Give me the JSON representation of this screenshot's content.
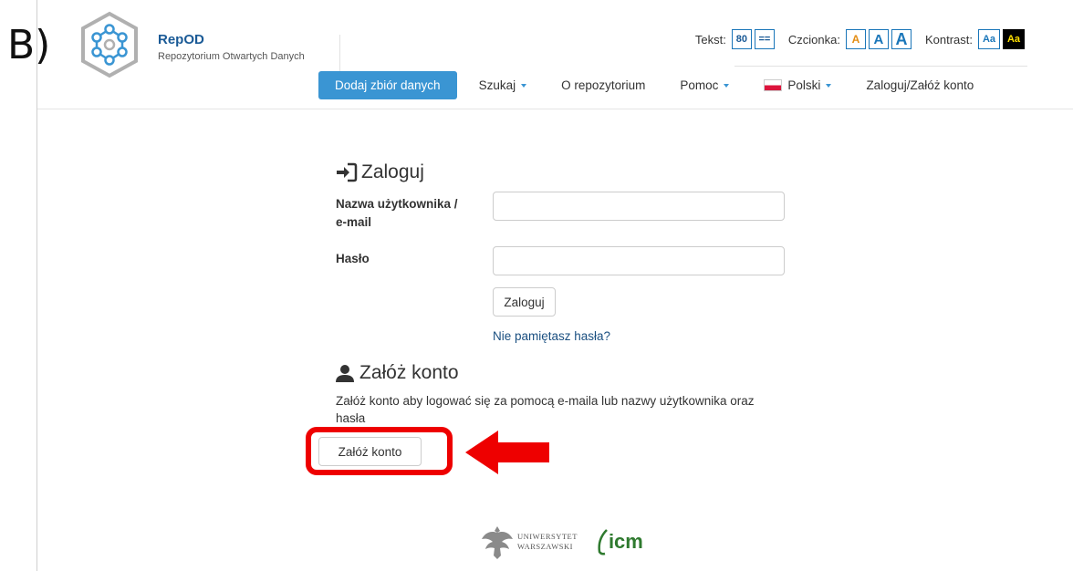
{
  "panel_label": "B)",
  "brand": {
    "title": "RepOD",
    "subtitle": "Repozytorium Otwartych Danych"
  },
  "accessibility": {
    "text_label": "Tekst:",
    "text_option_1": "80",
    "text_option_2": "==",
    "font_label": "Czcionka:",
    "font_small": "A",
    "font_medium": "A",
    "font_large": "A",
    "contrast_label": "Kontrast:",
    "contrast_normal": "Aa",
    "contrast_high": "Aa"
  },
  "nav": {
    "add_dataset": "Dodaj zbiór danych",
    "search": "Szukaj",
    "about": "O repozytorium",
    "help": "Pomoc",
    "language": "Polski",
    "login_signup": "Zaloguj/Załóż konto"
  },
  "login": {
    "title": "Zaloguj",
    "username_label_line1": "Nazwa użytkownika /",
    "username_label_line2": "e-mail",
    "username_value": "",
    "password_label": "Hasło",
    "password_value": "",
    "submit": "Zaloguj",
    "forgot": "Nie pamiętasz hasła?"
  },
  "signup": {
    "title": "Załóż konto",
    "description": "Załóż konto aby logować się za pomocą e-maila lub nazwy użytkownika oraz hasła",
    "button": "Załóż konto"
  },
  "footer": {
    "university_line1": "UNIWERSYTET",
    "university_line2": "WARSZAWSKI",
    "icm": "icm"
  },
  "colors": {
    "brand_blue": "#1a5a96",
    "nav_button": "#3a95d3",
    "annotation_red": "#ee0000",
    "icm_green": "#2f7a2f"
  }
}
